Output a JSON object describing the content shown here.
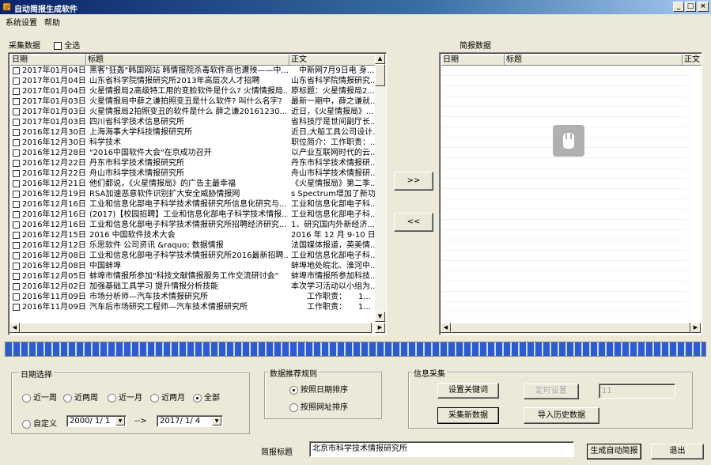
{
  "window": {
    "title": "自动简报生成软件",
    "minimize": "_",
    "maximize": "□",
    "close": "×"
  },
  "menu": [
    "系统设置",
    "帮助"
  ],
  "left_panel": {
    "label": "采集数据",
    "select_all": "全选",
    "columns": [
      "日期",
      "标题",
      "正文"
    ],
    "rows": [
      {
        "date": "2017年01月04日",
        "title": "黑客\"狂轰\"韩国网站 韩情报院杀毒软件商也遭殃——中...",
        "body": "　中新网7月9日电 身..."
      },
      {
        "date": "2017年01月04日",
        "title": "山东省科学院情报研究所2013年高层次人才招聘",
        "body": "山东省科学院情报研究..."
      },
      {
        "date": "2017年01月04日",
        "title": "火星情报局2高级特工用的变脸软件是什么? 火情情报局...",
        "body": "原标题：火星情报局2..."
      },
      {
        "date": "2017年01月03日",
        "title": "火星情报局中薛之谦拍照变丑是什么软件? 叫什么名字?",
        "body": "最新一期中，薛之谦就..."
      },
      {
        "date": "2017年01月03日",
        "title": "火星情报局2拍照变丑的软件是什么 薛之谦20161230...",
        "body": "近日，《火星情报局》..."
      },
      {
        "date": "2017年01月03日",
        "title": "四川省科学技术信息研究所",
        "body": "省科技厅是世间副厅长..."
      },
      {
        "date": "2016年12月30日",
        "title": "上海海事大学科技情报研究所",
        "body": "近日,大船工具公司设计..."
      },
      {
        "date": "2016年12月30日",
        "title": "科学技术",
        "body": "职位简介：工作职责：..."
      },
      {
        "date": "2016年12月28日",
        "title": "\"2016中国软件大会\"在京成功召开",
        "body": "以产业互联网时代的云..."
      },
      {
        "date": "2016年12月22日",
        "title": "丹东市科学技术情报研究所",
        "body": "丹东市科学技术情报研..."
      },
      {
        "date": "2016年12月22日",
        "title": "舟山市科学技术情报研究所",
        "body": "舟山市科学技术情报研..."
      },
      {
        "date": "2016年12月21日",
        "title": "他们都说，《火星情报局》的广告主最幸福",
        "body": "《火星情报局》第二季..."
      },
      {
        "date": "2016年12月19日",
        "title": "RSA加速恶意软件识别扩大安全威胁情报网",
        "body": "s Spectrum增加了新功..."
      },
      {
        "date": "2016年12月16日",
        "title": "工业和信息化部电子科学技术情报研究所信息化研究与...",
        "body": "工业和信息化部电子科..."
      },
      {
        "date": "2016年12月16日",
        "title": "(2017)【校园招聘】工业和信息化部电子科学技术情报...",
        "body": "工业和信息化部电子科..."
      },
      {
        "date": "2016年12月16日",
        "title": "工业和信息化部电子科学技术情报研究所招聘经济研究...",
        "body": "1、研究国内外新经济..."
      },
      {
        "date": "2016年12月15日",
        "title": "2016 中国软件技术大会",
        "body": "2016 年 12 月 9-10 日..."
      },
      {
        "date": "2016年12月12日",
        "title": "乐思软件 公司资讯 &raquo; 数据情报",
        "body": "法国媒体报道，英美情..."
      },
      {
        "date": "2016年12月08日",
        "title": "工业和信息化部电子科学技术情报研究所2016最新招聘...",
        "body": "工业和信息化部电子科..."
      },
      {
        "date": "2016年12月08日",
        "title": "中国蚌埠",
        "body": "蚌埠地处皖北、淮河中..."
      },
      {
        "date": "2016年12月05日",
        "title": "蚌埠市情报所参加\"科技文献情报服务工作交流研讨会\"",
        "body": "蚌埠市情报所参加科技..."
      },
      {
        "date": "2016年12月02日",
        "title": "加强基础工具学习 提升情报分析技能",
        "body": "本次学习活动以小组为..."
      },
      {
        "date": "2016年11月09日",
        "title": "市场分析师—汽车技术情报研究所",
        "body": "　　工作职责：　　1..."
      },
      {
        "date": "2016年11月09日",
        "title": "汽车后市场研究工程师—汽车技术情报研究所",
        "body": "　　工作职责：　　1..."
      }
    ]
  },
  "right_panel": {
    "label": "简报数据",
    "columns": [
      "日期",
      "标题",
      "正文"
    ]
  },
  "transfer": {
    "add": ">>",
    "remove": "<<"
  },
  "date_group": {
    "title": "日期选择",
    "options": [
      "近一周",
      "近两周",
      "近一月",
      "近两月",
      "全部"
    ],
    "selected": "全部",
    "custom": "自定义",
    "start": "2000/ 1/ 1",
    "arrow": "-->",
    "end": "2017/ 1/ 4"
  },
  "rule_group": {
    "title": "数据推荐规则",
    "options": [
      "按照日期排序",
      "按照网址排序"
    ],
    "selected": "按照日期排序"
  },
  "collect_group": {
    "title": "信息采集",
    "set_keywords": "设置关键词",
    "timer": "定时设置",
    "timer_value": "11",
    "collect_new": "采集新数据",
    "import_history": "导入历史数据"
  },
  "footer": {
    "title_label": "简报标题",
    "title_value": "北京市科学技术情报研究所",
    "generate": "生成自动简报",
    "exit": "退出"
  },
  "colors": {
    "title_start": "#0a246a",
    "title_end": "#a6caf0",
    "progress": "#2c5ad0",
    "face": "#ece9d8"
  }
}
